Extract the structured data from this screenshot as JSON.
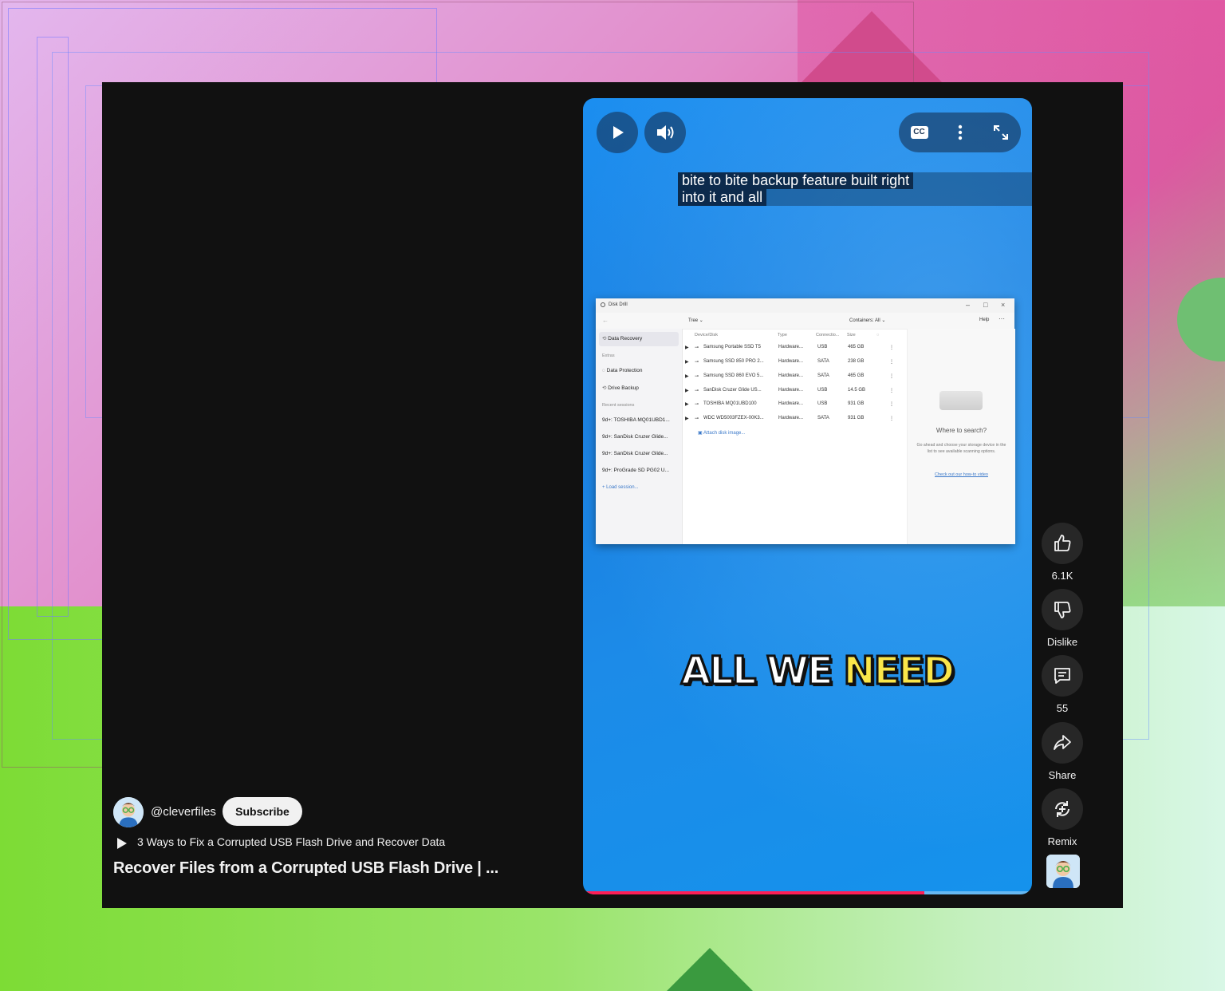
{
  "video": {
    "caption_line1": "bite to bite backup feature built right",
    "caption_line2": "into it and all",
    "overlay_word1": "ALL",
    "overlay_word2": "WE",
    "overlay_word3": "NEED",
    "progress_fraction": 0.76,
    "controls": {
      "play_icon": "play-icon",
      "volume_icon": "volume-icon",
      "cc_label": "CC",
      "more_icon": "more-vert-icon",
      "fullscreen_icon": "fullscreen-icon"
    }
  },
  "app_window": {
    "title": "Disk Drill",
    "toolbar_view": "Tree ⌄",
    "toolbar_containers": "Containers: All ⌄",
    "toolbar_help": "Help",
    "sidebar": {
      "data_recovery": "Data Recovery",
      "extras": "Extras",
      "data_protection": "Data Protection",
      "drive_backup": "Drive Backup",
      "recent_sessions": "Recent sessions",
      "sessions": [
        "9d+: TOSHIBA MQ01UBD1...",
        "9d+: SanDisk Cruzer Glide...",
        "9d+: SanDisk Cruzer Glide...",
        "9d+: ProGrade SD PG02 U..."
      ],
      "load_session": "Load session..."
    },
    "table": {
      "headers": [
        "Device/Disk",
        "Type",
        "Connectio...",
        "Size"
      ],
      "rows": [
        [
          "Samsung Portable SSD T5",
          "Hardware...",
          "USB",
          "465 GB"
        ],
        [
          "Samsung SSD 850 PRO 2...",
          "Hardware...",
          "SATA",
          "238 GB"
        ],
        [
          "Samsung SSD 860 EVO 5...",
          "Hardware...",
          "SATA",
          "465 GB"
        ],
        [
          "SanDisk Cruzer Glide US...",
          "Hardware...",
          "USB",
          "14.5 GB"
        ],
        [
          "TOSHIBA MQ01UBD100",
          "Hardware...",
          "USB",
          "931 GB"
        ],
        [
          "WDC WD5003FZEX-00K3...",
          "Hardware...",
          "SATA",
          "931 GB"
        ]
      ],
      "attach": "Attach disk image..."
    },
    "right_panel": {
      "title": "Where to search?",
      "desc": "Go ahead and choose your storage device in the list to see available scanning options.",
      "link": "Check out our how-to video"
    }
  },
  "actions": {
    "like_icon": "thumbs-up-icon",
    "like_count": "6.1K",
    "dislike_icon": "thumbs-down-icon",
    "dislike_label": "Dislike",
    "comment_icon": "comment-icon",
    "comment_count": "55",
    "share_icon": "share-icon",
    "share_label": "Share",
    "remix_icon": "remix-icon",
    "remix_label": "Remix"
  },
  "channel": {
    "handle": "@cleverfiles",
    "subscribe_label": "Subscribe",
    "related_video": "3 Ways to Fix a Corrupted USB Flash Drive and Recover Data",
    "video_title": "Recover Files from a Corrupted USB Flash Drive | ..."
  },
  "colors": {
    "progress": "#ff1e56",
    "overlay_yellow": "#fbe64a",
    "video_blue": "#1a85e6"
  }
}
